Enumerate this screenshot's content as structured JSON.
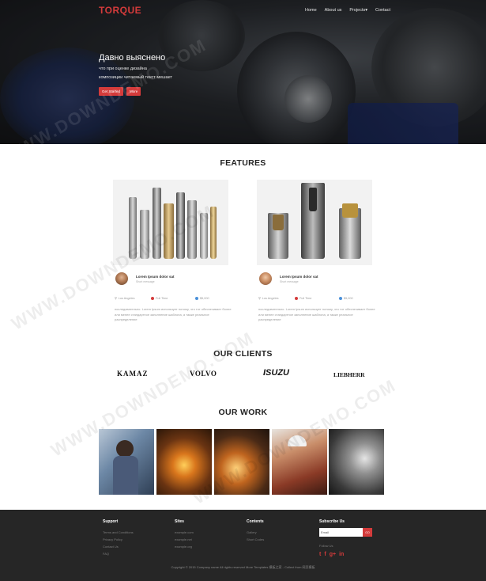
{
  "brand": "TORQUE",
  "nav": {
    "items": [
      "Home",
      "About us",
      "Projects",
      "Contact"
    ],
    "dropdown_glyph": "▾"
  },
  "hero": {
    "title": "Давно выяснено",
    "subtitle_line1": "что при оценке дизайна",
    "subtitle_line2": "композиции читаемый текст мешает",
    "btn_primary": "Get Started",
    "btn_secondary": "More"
  },
  "features": {
    "title": "FEATURES",
    "items": [
      {
        "author": "Lorem Ipsum dolor sat",
        "role": "Short message",
        "location": "Los Angeles",
        "time": "Full Time",
        "price": "$5,000",
        "description": "последовательно. Lorem Ipsum использует потому, что тот обеспечивает более или менее стандартное заполнение шаблона, а также реальное распределение"
      },
      {
        "author": "Lorem Ipsum dolor sat",
        "role": "Short message",
        "location": "Los Angeles",
        "time": "Full Time",
        "price": "$5,000",
        "description": "последовательно. Lorem Ipsum использует потому, что тот обеспечивает более или менее стандартное заполнение шаблона, а также реальное распределение"
      }
    ]
  },
  "clients": {
    "title": "OUR CLIENTS",
    "logos": [
      "KAMAZ",
      "VOLVO",
      "ISUZU",
      "LIEBHERR"
    ]
  },
  "work": {
    "title": "OUR WORK"
  },
  "footer": {
    "support": {
      "title": "Support",
      "links": [
        "Terms and Conditions",
        "Privacy Policy",
        "Contact Us",
        "FAQ"
      ]
    },
    "sites": {
      "title": "Sites",
      "links": [
        "example.com",
        "example.net",
        "example.org"
      ]
    },
    "contents": {
      "title": "Contents",
      "links": [
        "Gallery",
        "Short Codes"
      ]
    },
    "subscribe": {
      "title": "Subscribe Us",
      "email_placeholder": "Email",
      "button": "GO",
      "follow": "Follow Us"
    },
    "copyright": "Copyright © 2015 Company name All rights reserved More Templates 模板之家 - Collect from 网页模板"
  },
  "social_icons": [
    "twitter-icon",
    "facebook-icon",
    "google-plus-icon",
    "linkedin-icon"
  ],
  "watermark": "WWW.DOWNDEMO.COM",
  "colors": {
    "accent": "#d43b3b",
    "footer_bg": "#262626",
    "heading": "#222222"
  }
}
